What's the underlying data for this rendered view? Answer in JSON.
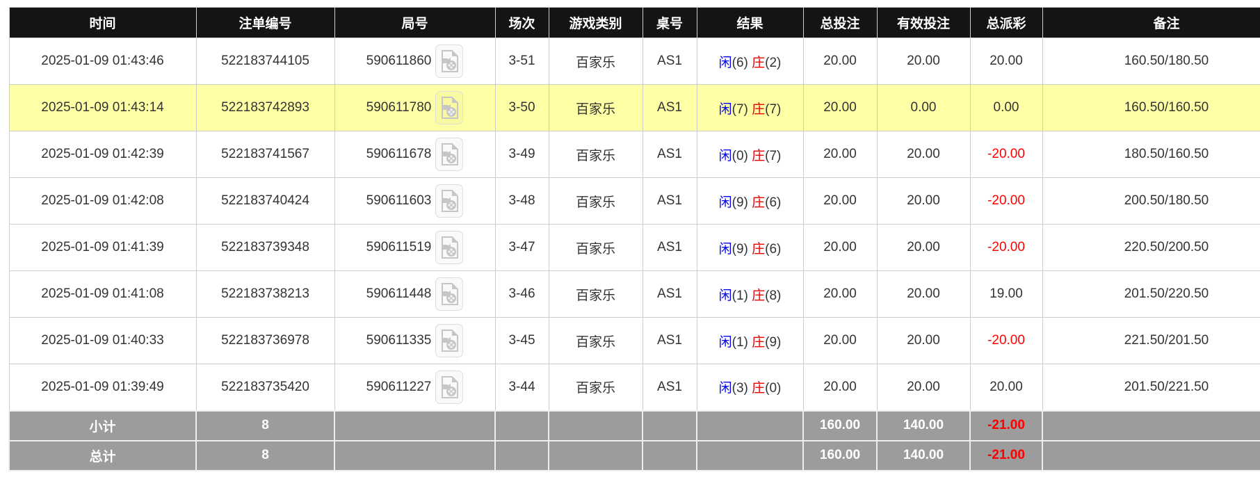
{
  "palette": {
    "header_bg": "#141414",
    "header_text": "#ffffff",
    "row_border": "#cccccc",
    "highlight_row_bg": "#ffffa6",
    "summary_bg": "#9c9c9c",
    "bet_amount_blue": "#0066ff",
    "player_blue": "#0000ee",
    "banker_red": "#ee0000",
    "negative_red": "#ff0000",
    "body_text": "#333333"
  },
  "icons": {
    "video": "video-replay-file-icon"
  },
  "table": {
    "columns": {
      "time": "时间",
      "bet_id": "注单编号",
      "round": "局号",
      "session": "场次",
      "game": "游戏类别",
      "table_no": "桌号",
      "result": "结果",
      "total_bet": "总投注",
      "valid_bet": "有效投注",
      "payout": "总派彩",
      "remark": "备注"
    },
    "rows": [
      {
        "time": "2025-01-09 01:43:46",
        "bet_id": "522183744105",
        "round": "590611860",
        "session": "3-51",
        "game": "百家乐",
        "table_no": "AS1",
        "result": {
          "player": "闲",
          "player_score": "(6)",
          "banker": "庄",
          "banker_score": "(2)"
        },
        "total_bet": "20.00",
        "valid_bet": "20.00",
        "payout": "20.00",
        "payout_color": "#333333",
        "remark": "160.50/180.50",
        "highlighted": false
      },
      {
        "time": "2025-01-09 01:43:14",
        "bet_id": "522183742893",
        "round": "590611780",
        "session": "3-50",
        "game": "百家乐",
        "table_no": "AS1",
        "result": {
          "player": "闲",
          "player_score": "(7)",
          "banker": "庄",
          "banker_score": "(7)"
        },
        "total_bet": "20.00",
        "valid_bet": "0.00",
        "payout": "0.00",
        "payout_color": "#333333",
        "remark": "160.50/160.50",
        "highlighted": true
      },
      {
        "time": "2025-01-09 01:42:39",
        "bet_id": "522183741567",
        "round": "590611678",
        "session": "3-49",
        "game": "百家乐",
        "table_no": "AS1",
        "result": {
          "player": "闲",
          "player_score": "(0)",
          "banker": "庄",
          "banker_score": "(7)"
        },
        "total_bet": "20.00",
        "valid_bet": "20.00",
        "payout": "-20.00",
        "payout_color": "#ff0000",
        "remark": "180.50/160.50",
        "highlighted": false
      },
      {
        "time": "2025-01-09 01:42:08",
        "bet_id": "522183740424",
        "round": "590611603",
        "session": "3-48",
        "game": "百家乐",
        "table_no": "AS1",
        "result": {
          "player": "闲",
          "player_score": "(9)",
          "banker": "庄",
          "banker_score": "(6)"
        },
        "total_bet": "20.00",
        "valid_bet": "20.00",
        "payout": "-20.00",
        "payout_color": "#ff0000",
        "remark": "200.50/180.50",
        "highlighted": false
      },
      {
        "time": "2025-01-09 01:41:39",
        "bet_id": "522183739348",
        "round": "590611519",
        "session": "3-47",
        "game": "百家乐",
        "table_no": "AS1",
        "result": {
          "player": "闲",
          "player_score": "(9)",
          "banker": "庄",
          "banker_score": "(6)"
        },
        "total_bet": "20.00",
        "valid_bet": "20.00",
        "payout": "-20.00",
        "payout_color": "#ff0000",
        "remark": "220.50/200.50",
        "highlighted": false
      },
      {
        "time": "2025-01-09 01:41:08",
        "bet_id": "522183738213",
        "round": "590611448",
        "session": "3-46",
        "game": "百家乐",
        "table_no": "AS1",
        "result": {
          "player": "闲",
          "player_score": "(1)",
          "banker": "庄",
          "banker_score": "(8)"
        },
        "total_bet": "20.00",
        "valid_bet": "20.00",
        "payout": "19.00",
        "payout_color": "#333333",
        "remark": "201.50/220.50",
        "highlighted": false
      },
      {
        "time": "2025-01-09 01:40:33",
        "bet_id": "522183736978",
        "round": "590611335",
        "session": "3-45",
        "game": "百家乐",
        "table_no": "AS1",
        "result": {
          "player": "闲",
          "player_score": "(1)",
          "banker": "庄",
          "banker_score": "(9)"
        },
        "total_bet": "20.00",
        "valid_bet": "20.00",
        "payout": "-20.00",
        "payout_color": "#ff0000",
        "remark": "221.50/201.50",
        "highlighted": false
      },
      {
        "time": "2025-01-09 01:39:49",
        "bet_id": "522183735420",
        "round": "590611227",
        "session": "3-44",
        "game": "百家乐",
        "table_no": "AS1",
        "result": {
          "player": "闲",
          "player_score": "(3)",
          "banker": "庄",
          "banker_score": "(0)"
        },
        "total_bet": "20.00",
        "valid_bet": "20.00",
        "payout": "20.00",
        "payout_color": "#333333",
        "remark": "201.50/221.50",
        "highlighted": false
      }
    ],
    "subtotal": {
      "label": "小计",
      "count": "8",
      "total_bet": "160.00",
      "valid_bet": "140.00",
      "payout": "-21.00"
    },
    "total": {
      "label": "总计",
      "count": "8",
      "total_bet": "160.00",
      "valid_bet": "140.00",
      "payout": "-21.00"
    }
  }
}
